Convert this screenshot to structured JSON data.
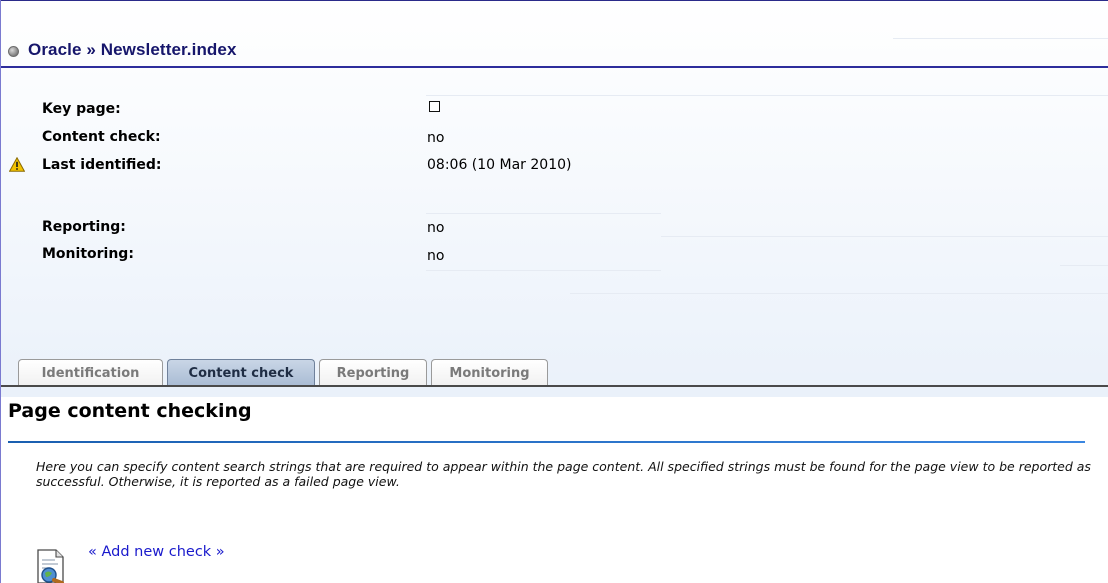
{
  "breadcrumb": {
    "root": "Oracle",
    "separator": "»",
    "page": "Newsletter.index"
  },
  "properties": {
    "key_page": {
      "label": "Key page:",
      "checked": false
    },
    "content_check": {
      "label": "Content check:",
      "value": "no"
    },
    "last_identified": {
      "label": "Last identified:",
      "value": "08:06 (10 Mar 2010)",
      "icon": "warning-icon"
    },
    "reporting": {
      "label": "Reporting:",
      "value": "no"
    },
    "monitoring": {
      "label": "Monitoring:",
      "value": "no"
    }
  },
  "tabs": [
    {
      "label": "Identification",
      "active": false
    },
    {
      "label": "Content check",
      "active": true
    },
    {
      "label": "Reporting",
      "active": false
    },
    {
      "label": "Monitoring",
      "active": false
    }
  ],
  "section": {
    "title": "Page content checking",
    "description": "Here you can specify content search strings that are required to appear within the page content. All specified strings must be found for the page view to be reported as successful. Otherwise, it is reported as a failed page view.",
    "add_link": "« Add new check »",
    "add_icon": "document-search-icon"
  },
  "colors": {
    "title": "#16166b",
    "title_rule": "#2d2d9c",
    "active_tab": "#b5c6dc",
    "section_rule": "#2a76d2",
    "link": "#1a1acc",
    "warning": "#f2c200"
  }
}
